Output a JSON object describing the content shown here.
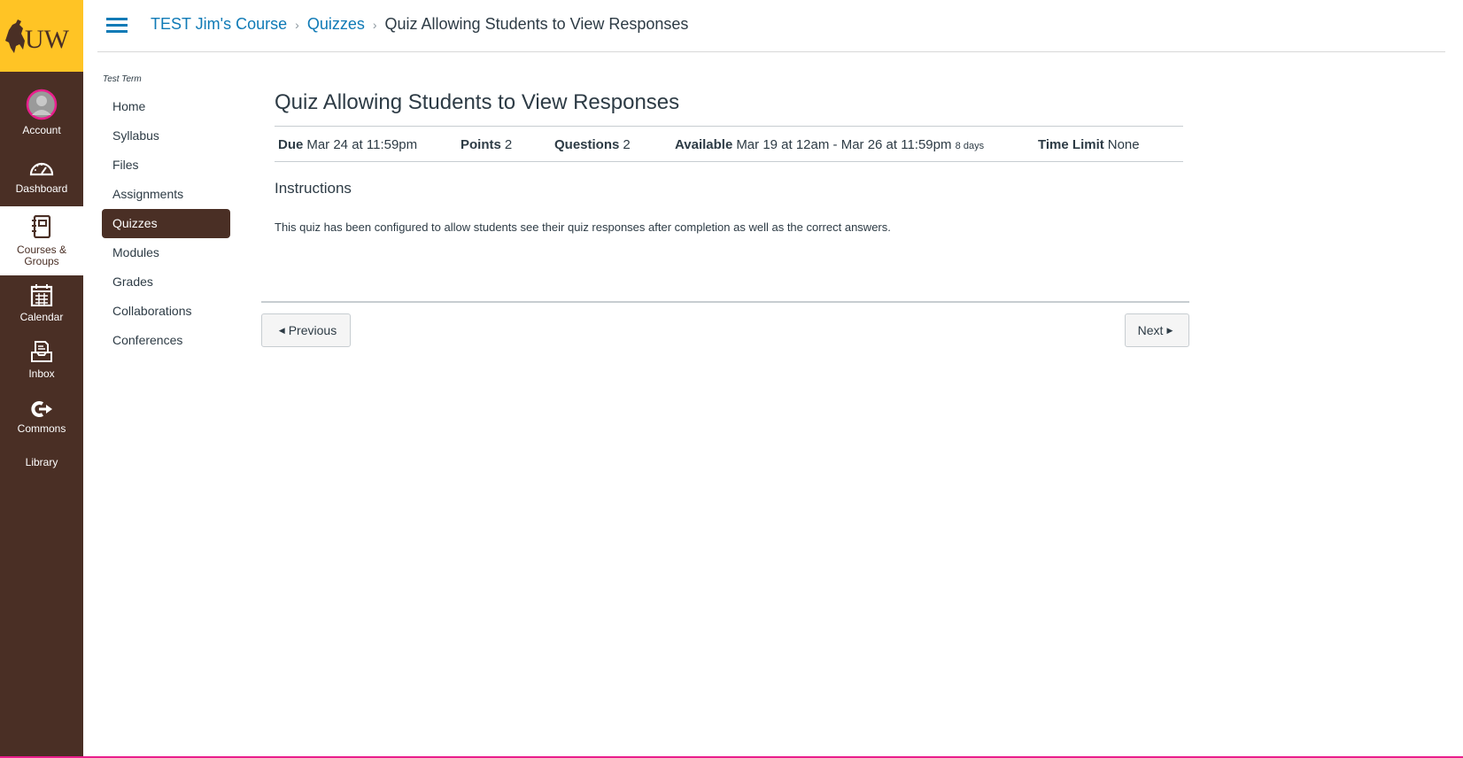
{
  "global_nav": {
    "logo_text": "UW",
    "items": [
      {
        "label": "Account",
        "icon": "avatar-icon"
      },
      {
        "label": "Dashboard",
        "icon": "speedometer-icon"
      },
      {
        "label": "Courses & Groups",
        "icon": "notebook-icon",
        "active": true
      },
      {
        "label": "Calendar",
        "icon": "calendar-icon"
      },
      {
        "label": "Inbox",
        "icon": "inbox-icon"
      },
      {
        "label": "Commons",
        "icon": "commons-icon"
      },
      {
        "label": "Library",
        "icon": ""
      }
    ],
    "accent_color": "#e91e8c",
    "brand_color": "#4a2f25",
    "logo_bg": "#ffc425"
  },
  "breadcrumb": {
    "course": "TEST Jim's Course",
    "section": "Quizzes",
    "current": "Quiz Allowing Students to View Responses",
    "separator": "›"
  },
  "course_nav": {
    "term": "Test Term",
    "items": [
      "Home",
      "Syllabus",
      "Files",
      "Assignments",
      "Quizzes",
      "Modules",
      "Grades",
      "Collaborations",
      "Conferences"
    ],
    "active": "Quizzes"
  },
  "quiz": {
    "title": "Quiz Allowing Students to View Responses",
    "due_label": "Due",
    "due_value": "Mar 24 at 11:59pm",
    "points_label": "Points",
    "points_value": "2",
    "questions_label": "Questions",
    "questions_value": "2",
    "available_label": "Available",
    "available_value": "Mar 19 at 12am - Mar 26 at 11:59pm",
    "available_duration": "8 days",
    "time_limit_label": "Time Limit",
    "time_limit_value": "None",
    "instructions_heading": "Instructions",
    "instructions_text": "This quiz has been configured to allow students see their quiz responses after completion as well as the correct answers."
  },
  "footer": {
    "previous_label": "Previous",
    "next_label": "Next"
  }
}
